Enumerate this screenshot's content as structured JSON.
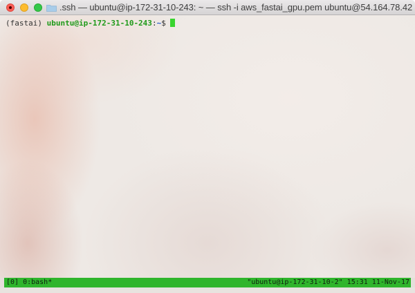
{
  "window": {
    "title": ".ssh — ubuntu@ip-172-31-10-243: ~ — ssh -i aws_fastai_gpu.pem ubuntu@54.164.78.42 -...",
    "folder_icon": "folder-icon",
    "traffic_lights": {
      "close_color": "#fc5f57",
      "minimize_color": "#fdbc2e",
      "maximize_color": "#34c84a"
    }
  },
  "terminal": {
    "env_label": "(fastai)",
    "user_host": "ubuntu@ip-172-31-10-243",
    "separator": ":",
    "path": "~",
    "prompt_symbol": "$",
    "cursor_color": "#39d42f"
  },
  "statusbar": {
    "left": "[0] 0:bash*",
    "right": "\"ubuntu@ip-172-31-10-2\" 15:31 11-Nov-17",
    "color": "#2fb52c"
  }
}
